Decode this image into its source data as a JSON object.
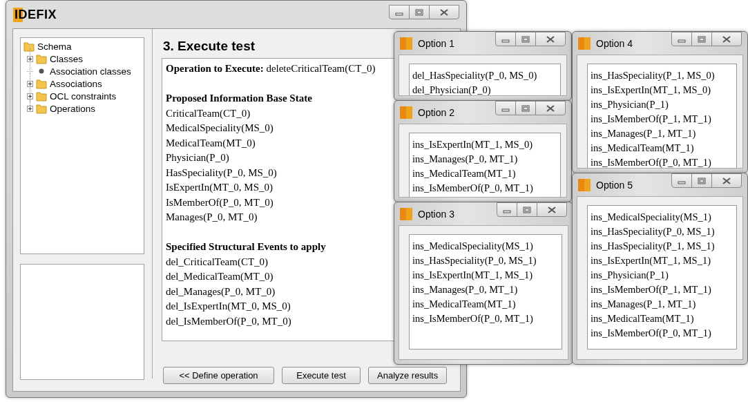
{
  "main_window": {
    "title": "IDEFIX",
    "tree": {
      "label": "Schema",
      "kind": "folder",
      "children": [
        {
          "label": "Classes",
          "kind": "folder",
          "expanded": false
        },
        {
          "label": "Association classes",
          "kind": "leaf"
        },
        {
          "label": "Associations",
          "kind": "folder",
          "expanded": false
        },
        {
          "label": "OCL constraints",
          "kind": "folder",
          "expanded": false
        },
        {
          "label": "Operations",
          "kind": "folder",
          "expanded": false
        }
      ]
    },
    "heading": "3. Execute test",
    "operation": "**Operation to Execute:** deleteCriticalTeam(CT_0)",
    "sections": [
      {
        "heading": "Proposed Information Base State",
        "lines": [
          "CriticalTeam(CT_0)",
          "MedicalSpeciality(MS_0)",
          "MedicalTeam(MT_0)",
          "Physician(P_0)",
          "HasSpeciality(P_0, MS_0)",
          "IsExpertIn(MT_0, MS_0)",
          "IsMemberOf(P_0, MT_0)",
          "Manages(P_0, MT_0)"
        ]
      },
      {
        "heading": "Specified Structural Events to apply",
        "lines": [
          "del_CriticalTeam(CT_0)",
          "del_MedicalTeam(MT_0)",
          "del_Manages(P_0, MT_0)",
          "del_IsExpertIn(MT_0, MS_0)",
          "del_IsMemberOf(P_0, MT_0)"
        ]
      }
    ],
    "buttons": [
      "<< Define operation",
      "Execute test",
      "Analyze results"
    ]
  },
  "option_windows": [
    {
      "title": "Option 1",
      "lines": [
        "del_HasSpeciality(P_0, MS_0)",
        "del_Physician(P_0)"
      ]
    },
    {
      "title": "Option 2",
      "lines": [
        "ins_IsExpertIn(MT_1, MS_0)",
        "ins_Manages(P_0, MT_1)",
        "ins_MedicalTeam(MT_1)",
        "ins_IsMemberOf(P_0, MT_1)"
      ]
    },
    {
      "title": "Option 3",
      "lines": [
        "ins_MedicalSpeciality(MS_1)",
        "ins_HasSpeciality(P_0, MS_1)",
        "ins_IsExpertIn(MT_1, MS_1)",
        "ins_Manages(P_0, MT_1)",
        "ins_MedicalTeam(MT_1)",
        "ins_IsMemberOf(P_0, MT_1)"
      ]
    },
    {
      "title": "Option 4",
      "lines": [
        "ins_HasSpeciality(P_1, MS_0)",
        "ins_IsExpertIn(MT_1, MS_0)",
        "ins_Physician(P_1)",
        "ins_IsMemberOf(P_1, MT_1)",
        "ins_Manages(P_1, MT_1)",
        "ins_MedicalTeam(MT_1)",
        "ins_IsMemberOf(P_0, MT_1)"
      ]
    },
    {
      "title": "Option 5",
      "lines": [
        "ins_MedicalSpeciality(MS_1)",
        "ins_HasSpeciality(P_0, MS_1)",
        "ins_HasSpeciality(P_1, MS_1)",
        "ins_IsExpertIn(MT_1, MS_1)",
        "ins_Physician(P_1)",
        "ins_IsMemberOf(P_1, MT_1)",
        "ins_Manages(P_1, MT_1)",
        "ins_MedicalTeam(MT_1)",
        "ins_IsMemberOf(P_0, MT_1)"
      ]
    }
  ]
}
